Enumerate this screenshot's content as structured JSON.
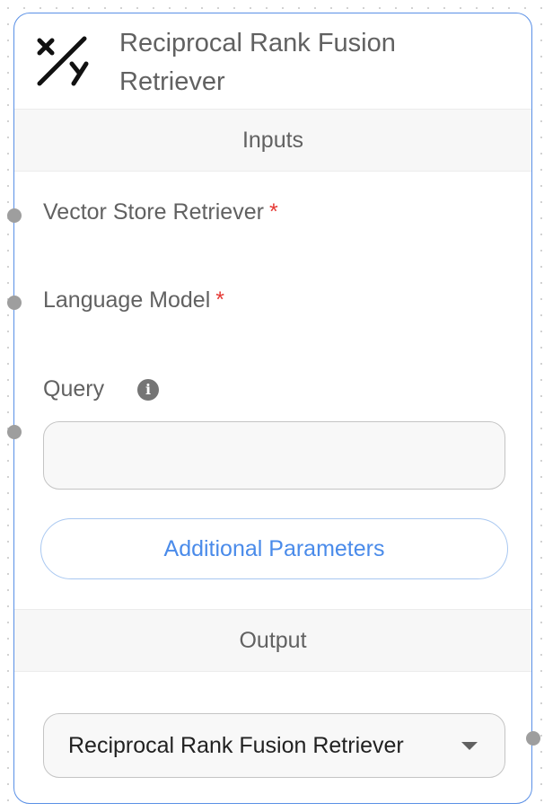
{
  "node": {
    "title": "Reciprocal Rank Fusion Retriever",
    "icon": "variable-x-over-y-icon",
    "accent_color": "#5a90e6"
  },
  "inputs_section": {
    "heading": "Inputs",
    "fields": [
      {
        "label": "Vector Store Retriever",
        "required_marker": "*"
      },
      {
        "label": "Language Model",
        "required_marker": "*"
      },
      {
        "label": "Query",
        "info_icon": "info-icon",
        "value": "",
        "placeholder": ""
      }
    ],
    "additional_parameters_label": "Additional Parameters"
  },
  "output_section": {
    "heading": "Output",
    "selected_value": "Reciprocal Rank Fusion Retriever",
    "dropdown_icon": "caret-down-icon"
  },
  "colors": {
    "required": "#e53935",
    "link": "#4a8bea",
    "handle": "#9e9e9e"
  }
}
